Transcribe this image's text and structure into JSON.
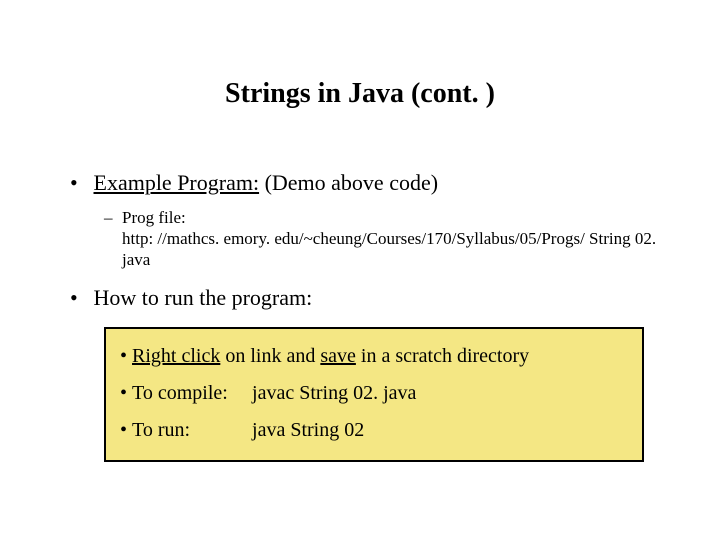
{
  "title": "Strings in Java (cont. )",
  "bullets": {
    "example": {
      "label_u": "Example Program:",
      "label_rest": " (Demo above code)"
    },
    "progfile": {
      "label": "Prog file:",
      "url": "http: //mathcs. emory. edu/~cheung/Courses/170/Syllabus/05/Progs/ String 02. java"
    },
    "howto": "How to run the program:"
  },
  "box": {
    "line1": {
      "pre": "• ",
      "u1": "Right click",
      "mid": " on link and ",
      "u2": "save",
      "post": " in a scratch directory"
    },
    "line2": {
      "pre": "• ",
      "label": "To compile:   ",
      "cmd": "javac String 02. java"
    },
    "line3": {
      "pre": "• ",
      "label": "To run:          ",
      "cmd": "java String 02"
    }
  }
}
